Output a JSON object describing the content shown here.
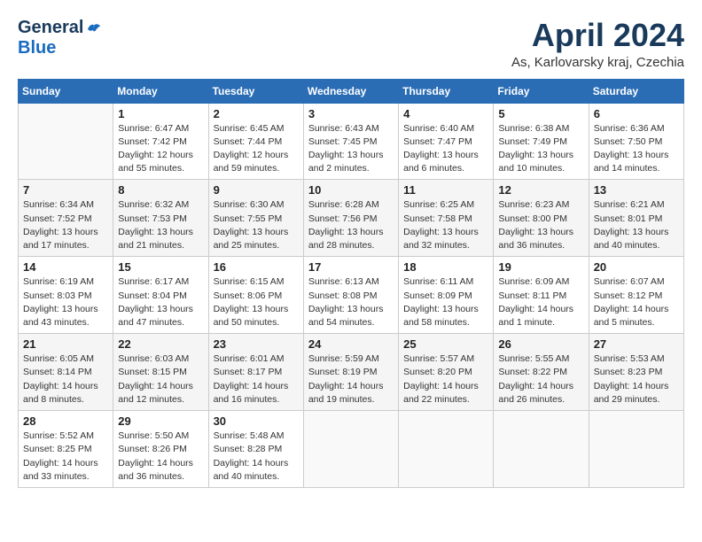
{
  "header": {
    "logo_general": "General",
    "logo_blue": "Blue",
    "month_title": "April 2024",
    "location": "As, Karlovarsky kraj, Czechia"
  },
  "calendar": {
    "days_of_week": [
      "Sunday",
      "Monday",
      "Tuesday",
      "Wednesday",
      "Thursday",
      "Friday",
      "Saturday"
    ],
    "weeks": [
      [
        {
          "day": "",
          "sunrise": "",
          "sunset": "",
          "daylight": ""
        },
        {
          "day": "1",
          "sunrise": "Sunrise: 6:47 AM",
          "sunset": "Sunset: 7:42 PM",
          "daylight": "Daylight: 12 hours and 55 minutes."
        },
        {
          "day": "2",
          "sunrise": "Sunrise: 6:45 AM",
          "sunset": "Sunset: 7:44 PM",
          "daylight": "Daylight: 12 hours and 59 minutes."
        },
        {
          "day": "3",
          "sunrise": "Sunrise: 6:43 AM",
          "sunset": "Sunset: 7:45 PM",
          "daylight": "Daylight: 13 hours and 2 minutes."
        },
        {
          "day": "4",
          "sunrise": "Sunrise: 6:40 AM",
          "sunset": "Sunset: 7:47 PM",
          "daylight": "Daylight: 13 hours and 6 minutes."
        },
        {
          "day": "5",
          "sunrise": "Sunrise: 6:38 AM",
          "sunset": "Sunset: 7:49 PM",
          "daylight": "Daylight: 13 hours and 10 minutes."
        },
        {
          "day": "6",
          "sunrise": "Sunrise: 6:36 AM",
          "sunset": "Sunset: 7:50 PM",
          "daylight": "Daylight: 13 hours and 14 minutes."
        }
      ],
      [
        {
          "day": "7",
          "sunrise": "Sunrise: 6:34 AM",
          "sunset": "Sunset: 7:52 PM",
          "daylight": "Daylight: 13 hours and 17 minutes."
        },
        {
          "day": "8",
          "sunrise": "Sunrise: 6:32 AM",
          "sunset": "Sunset: 7:53 PM",
          "daylight": "Daylight: 13 hours and 21 minutes."
        },
        {
          "day": "9",
          "sunrise": "Sunrise: 6:30 AM",
          "sunset": "Sunset: 7:55 PM",
          "daylight": "Daylight: 13 hours and 25 minutes."
        },
        {
          "day": "10",
          "sunrise": "Sunrise: 6:28 AM",
          "sunset": "Sunset: 7:56 PM",
          "daylight": "Daylight: 13 hours and 28 minutes."
        },
        {
          "day": "11",
          "sunrise": "Sunrise: 6:25 AM",
          "sunset": "Sunset: 7:58 PM",
          "daylight": "Daylight: 13 hours and 32 minutes."
        },
        {
          "day": "12",
          "sunrise": "Sunrise: 6:23 AM",
          "sunset": "Sunset: 8:00 PM",
          "daylight": "Daylight: 13 hours and 36 minutes."
        },
        {
          "day": "13",
          "sunrise": "Sunrise: 6:21 AM",
          "sunset": "Sunset: 8:01 PM",
          "daylight": "Daylight: 13 hours and 40 minutes."
        }
      ],
      [
        {
          "day": "14",
          "sunrise": "Sunrise: 6:19 AM",
          "sunset": "Sunset: 8:03 PM",
          "daylight": "Daylight: 13 hours and 43 minutes."
        },
        {
          "day": "15",
          "sunrise": "Sunrise: 6:17 AM",
          "sunset": "Sunset: 8:04 PM",
          "daylight": "Daylight: 13 hours and 47 minutes."
        },
        {
          "day": "16",
          "sunrise": "Sunrise: 6:15 AM",
          "sunset": "Sunset: 8:06 PM",
          "daylight": "Daylight: 13 hours and 50 minutes."
        },
        {
          "day": "17",
          "sunrise": "Sunrise: 6:13 AM",
          "sunset": "Sunset: 8:08 PM",
          "daylight": "Daylight: 13 hours and 54 minutes."
        },
        {
          "day": "18",
          "sunrise": "Sunrise: 6:11 AM",
          "sunset": "Sunset: 8:09 PM",
          "daylight": "Daylight: 13 hours and 58 minutes."
        },
        {
          "day": "19",
          "sunrise": "Sunrise: 6:09 AM",
          "sunset": "Sunset: 8:11 PM",
          "daylight": "Daylight: 14 hours and 1 minute."
        },
        {
          "day": "20",
          "sunrise": "Sunrise: 6:07 AM",
          "sunset": "Sunset: 8:12 PM",
          "daylight": "Daylight: 14 hours and 5 minutes."
        }
      ],
      [
        {
          "day": "21",
          "sunrise": "Sunrise: 6:05 AM",
          "sunset": "Sunset: 8:14 PM",
          "daylight": "Daylight: 14 hours and 8 minutes."
        },
        {
          "day": "22",
          "sunrise": "Sunrise: 6:03 AM",
          "sunset": "Sunset: 8:15 PM",
          "daylight": "Daylight: 14 hours and 12 minutes."
        },
        {
          "day": "23",
          "sunrise": "Sunrise: 6:01 AM",
          "sunset": "Sunset: 8:17 PM",
          "daylight": "Daylight: 14 hours and 16 minutes."
        },
        {
          "day": "24",
          "sunrise": "Sunrise: 5:59 AM",
          "sunset": "Sunset: 8:19 PM",
          "daylight": "Daylight: 14 hours and 19 minutes."
        },
        {
          "day": "25",
          "sunrise": "Sunrise: 5:57 AM",
          "sunset": "Sunset: 8:20 PM",
          "daylight": "Daylight: 14 hours and 22 minutes."
        },
        {
          "day": "26",
          "sunrise": "Sunrise: 5:55 AM",
          "sunset": "Sunset: 8:22 PM",
          "daylight": "Daylight: 14 hours and 26 minutes."
        },
        {
          "day": "27",
          "sunrise": "Sunrise: 5:53 AM",
          "sunset": "Sunset: 8:23 PM",
          "daylight": "Daylight: 14 hours and 29 minutes."
        }
      ],
      [
        {
          "day": "28",
          "sunrise": "Sunrise: 5:52 AM",
          "sunset": "Sunset: 8:25 PM",
          "daylight": "Daylight: 14 hours and 33 minutes."
        },
        {
          "day": "29",
          "sunrise": "Sunrise: 5:50 AM",
          "sunset": "Sunset: 8:26 PM",
          "daylight": "Daylight: 14 hours and 36 minutes."
        },
        {
          "day": "30",
          "sunrise": "Sunrise: 5:48 AM",
          "sunset": "Sunset: 8:28 PM",
          "daylight": "Daylight: 14 hours and 40 minutes."
        },
        {
          "day": "",
          "sunrise": "",
          "sunset": "",
          "daylight": ""
        },
        {
          "day": "",
          "sunrise": "",
          "sunset": "",
          "daylight": ""
        },
        {
          "day": "",
          "sunrise": "",
          "sunset": "",
          "daylight": ""
        },
        {
          "day": "",
          "sunrise": "",
          "sunset": "",
          "daylight": ""
        }
      ]
    ]
  }
}
